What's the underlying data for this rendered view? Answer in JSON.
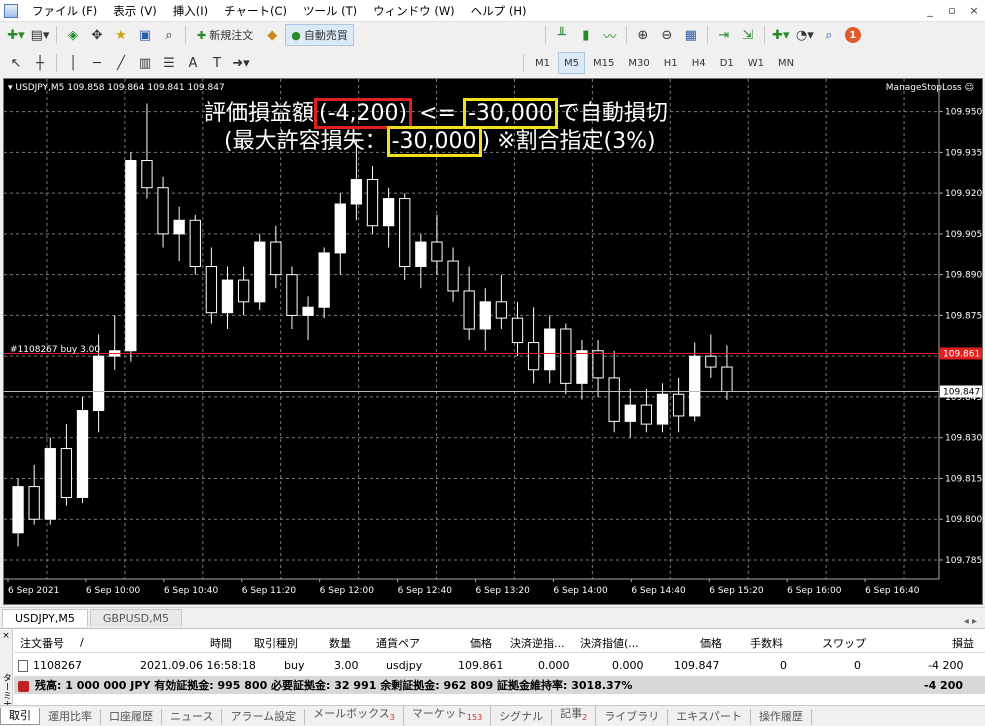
{
  "menubar": {
    "items": [
      "ファイル (F)",
      "表示 (V)",
      "挿入(I)",
      "チャート(C)",
      "ツール (T)",
      "ウィンドウ (W)",
      "ヘルプ (H)"
    ],
    "window_controls": [
      "_",
      "▫",
      "×"
    ]
  },
  "toolbar": {
    "new_order": "新規注文",
    "auto_trade": "自動売買",
    "timeframes": [
      "M1",
      "M5",
      "M15",
      "M30",
      "H1",
      "H4",
      "D1",
      "W1",
      "MN"
    ],
    "active_timeframe": "M5",
    "notifications": "1"
  },
  "chart": {
    "symbol_info": "USDJPY,M5  109.858 109.864 109.841 109.847",
    "ea_name": "ManageStopLoss",
    "notice_line1": {
      "prefix": "評価損益額",
      "current": "(-4,200)",
      "middle": " <= ",
      "threshold": "-30,000",
      "suffix": "で自動損切"
    },
    "notice_line2": {
      "prefix": "(最大許容損失：",
      "max_loss": "-30,000",
      "suffix": ") ※割合指定(3%)"
    },
    "order_label": "#1108267 buy 3.00",
    "price_labels": [
      "109.950",
      "109.935",
      "109.920",
      "109.905",
      "109.890",
      "109.875",
      "109.860",
      "109.845",
      "109.830",
      "109.815",
      "109.800",
      "109.785"
    ],
    "time_labels": [
      "6 Sep 2021",
      "6 Sep 10:00",
      "6 Sep 10:40",
      "6 Sep 11:20",
      "6 Sep 12:00",
      "6 Sep 12:40",
      "6 Sep 13:20",
      "6 Sep 14:00",
      "6 Sep 14:40",
      "6 Sep 15:20",
      "6 Sep 16:00",
      "6 Sep 16:40"
    ],
    "open_price_tag": "109.861",
    "bid_price_tag": "109.847",
    "colors": {
      "background": "#000000",
      "candle": "#ffffff",
      "bull_fill": "#ffffff",
      "order_line": "#e02020",
      "grid": "#7a7a7a"
    }
  },
  "chart_data": {
    "type": "candlestick",
    "timeframe": "M5",
    "ylim": [
      109.778,
      109.962
    ],
    "candles": [
      {
        "o": 109.795,
        "h": 109.815,
        "l": 109.79,
        "c": 109.812
      },
      {
        "o": 109.812,
        "h": 109.82,
        "l": 109.798,
        "c": 109.8
      },
      {
        "o": 109.8,
        "h": 109.83,
        "l": 109.798,
        "c": 109.826
      },
      {
        "o": 109.826,
        "h": 109.835,
        "l": 109.805,
        "c": 109.808
      },
      {
        "o": 109.808,
        "h": 109.845,
        "l": 109.806,
        "c": 109.84
      },
      {
        "o": 109.84,
        "h": 109.868,
        "l": 109.832,
        "c": 109.86
      },
      {
        "o": 109.86,
        "h": 109.875,
        "l": 109.855,
        "c": 109.862
      },
      {
        "o": 109.862,
        "h": 109.935,
        "l": 109.858,
        "c": 109.932
      },
      {
        "o": 109.932,
        "h": 109.953,
        "l": 109.918,
        "c": 109.922
      },
      {
        "o": 109.922,
        "h": 109.926,
        "l": 109.9,
        "c": 109.905
      },
      {
        "o": 109.905,
        "h": 109.915,
        "l": 109.895,
        "c": 109.91
      },
      {
        "o": 109.91,
        "h": 109.912,
        "l": 109.89,
        "c": 109.893
      },
      {
        "o": 109.893,
        "h": 109.9,
        "l": 109.872,
        "c": 109.876
      },
      {
        "o": 109.876,
        "h": 109.893,
        "l": 109.87,
        "c": 109.888
      },
      {
        "o": 109.888,
        "h": 109.893,
        "l": 109.875,
        "c": 109.88
      },
      {
        "o": 109.88,
        "h": 109.905,
        "l": 109.877,
        "c": 109.902
      },
      {
        "o": 109.902,
        "h": 109.908,
        "l": 109.885,
        "c": 109.89
      },
      {
        "o": 109.89,
        "h": 109.893,
        "l": 109.87,
        "c": 109.875
      },
      {
        "o": 109.875,
        "h": 109.882,
        "l": 109.866,
        "c": 109.878
      },
      {
        "o": 109.878,
        "h": 109.9,
        "l": 109.874,
        "c": 109.898
      },
      {
        "o": 109.898,
        "h": 109.92,
        "l": 109.89,
        "c": 109.916
      },
      {
        "o": 109.916,
        "h": 109.94,
        "l": 109.91,
        "c": 109.925
      },
      {
        "o": 109.925,
        "h": 109.93,
        "l": 109.905,
        "c": 109.908
      },
      {
        "o": 109.908,
        "h": 109.922,
        "l": 109.9,
        "c": 109.918
      },
      {
        "o": 109.918,
        "h": 109.92,
        "l": 109.888,
        "c": 109.893
      },
      {
        "o": 109.893,
        "h": 109.905,
        "l": 109.885,
        "c": 109.902
      },
      {
        "o": 109.902,
        "h": 109.912,
        "l": 109.89,
        "c": 109.895
      },
      {
        "o": 109.895,
        "h": 109.9,
        "l": 109.88,
        "c": 109.884
      },
      {
        "o": 109.884,
        "h": 109.893,
        "l": 109.866,
        "c": 109.87
      },
      {
        "o": 109.87,
        "h": 109.885,
        "l": 109.862,
        "c": 109.88
      },
      {
        "o": 109.88,
        "h": 109.89,
        "l": 109.87,
        "c": 109.874
      },
      {
        "o": 109.874,
        "h": 109.88,
        "l": 109.86,
        "c": 109.865
      },
      {
        "o": 109.865,
        "h": 109.878,
        "l": 109.85,
        "c": 109.855
      },
      {
        "o": 109.855,
        "h": 109.875,
        "l": 109.85,
        "c": 109.87
      },
      {
        "o": 109.87,
        "h": 109.872,
        "l": 109.846,
        "c": 109.85
      },
      {
        "o": 109.85,
        "h": 109.866,
        "l": 109.844,
        "c": 109.862
      },
      {
        "o": 109.862,
        "h": 109.866,
        "l": 109.845,
        "c": 109.852
      },
      {
        "o": 109.852,
        "h": 109.862,
        "l": 109.832,
        "c": 109.836
      },
      {
        "o": 109.836,
        "h": 109.848,
        "l": 109.83,
        "c": 109.842
      },
      {
        "o": 109.842,
        "h": 109.848,
        "l": 109.832,
        "c": 109.835
      },
      {
        "o": 109.835,
        "h": 109.85,
        "l": 109.832,
        "c": 109.846
      },
      {
        "o": 109.846,
        "h": 109.852,
        "l": 109.832,
        "c": 109.838
      },
      {
        "o": 109.838,
        "h": 109.865,
        "l": 109.836,
        "c": 109.86
      },
      {
        "o": 109.86,
        "h": 109.868,
        "l": 109.852,
        "c": 109.856
      },
      {
        "o": 109.856,
        "h": 109.864,
        "l": 109.844,
        "c": 109.847
      }
    ]
  },
  "tabs": [
    "USDJPY,M5",
    "GBPUSD,M5"
  ],
  "tab_nav": "◂ ▸",
  "terminal": {
    "side_close": "×",
    "side_label": "ターミナル",
    "headers": [
      "注文番号",
      "/",
      "時間",
      "取引種別",
      "数量",
      "通貨ペア",
      "価格",
      "決済逆指...",
      "決済指値(...",
      "価格",
      "手数料",
      "スワップ",
      "損益"
    ],
    "row": [
      "1108267",
      "2021.09.06 16:58:18",
      "buy",
      "3.00",
      "usdjpy",
      "109.861",
      "0.000",
      "0.000",
      "109.847",
      "0",
      "0",
      "-4 200"
    ],
    "balance": "残高: 1 000 000 JPY  有効証拠金: 995 800  必要証拠金: 32 991  余剰証拠金: 962 809  証拠金維持率: 3018.37%",
    "balance_pl": "-4 200",
    "tabs": [
      {
        "label": "取引",
        "badge": ""
      },
      {
        "label": "運用比率",
        "badge": ""
      },
      {
        "label": "口座履歴",
        "badge": ""
      },
      {
        "label": "ニュース",
        "badge": ""
      },
      {
        "label": "アラーム設定",
        "badge": ""
      },
      {
        "label": "メールボックス",
        "badge": "3"
      },
      {
        "label": "マーケット",
        "badge": "153"
      },
      {
        "label": "シグナル",
        "badge": ""
      },
      {
        "label": "記事",
        "badge": "2"
      },
      {
        "label": "ライブラリ",
        "badge": ""
      },
      {
        "label": "エキスパート",
        "badge": ""
      },
      {
        "label": "操作履歴",
        "badge": ""
      }
    ]
  }
}
